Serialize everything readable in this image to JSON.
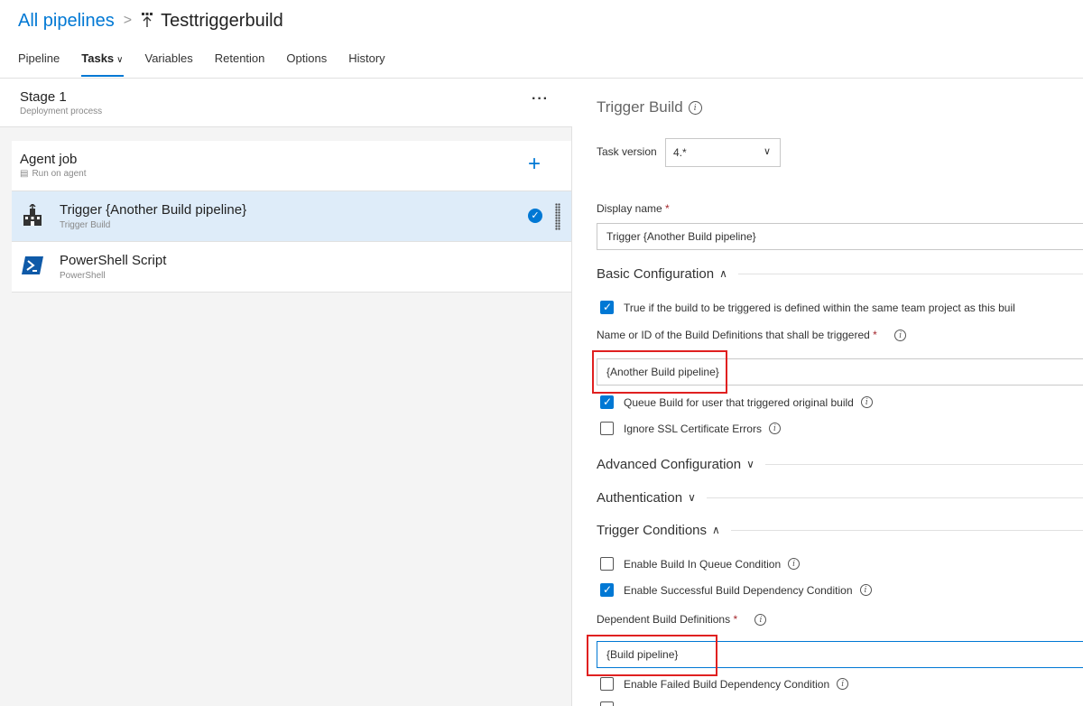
{
  "breadcrumb": {
    "root": "All pipelines",
    "separator": ">",
    "title": "Testtriggerbuild"
  },
  "tabs": [
    {
      "label": "Pipeline"
    },
    {
      "label": "Tasks",
      "active": true
    },
    {
      "label": "Variables"
    },
    {
      "label": "Retention"
    },
    {
      "label": "Options"
    },
    {
      "label": "History"
    }
  ],
  "stage": {
    "title": "Stage 1",
    "subtitle": "Deployment process",
    "more": "···"
  },
  "agent_job": {
    "title": "Agent job",
    "subtitle": "Run on agent",
    "add": "+"
  },
  "tasks": [
    {
      "title": "Trigger {Another Build pipeline}",
      "subtitle": "Trigger Build",
      "selected": true,
      "icon": "factory-icon"
    },
    {
      "title": "PowerShell Script",
      "subtitle": "PowerShell",
      "selected": false,
      "icon": "powershell-icon"
    }
  ],
  "panel": {
    "title": "Trigger Build",
    "task_version_label": "Task version",
    "task_version_value": "4.*",
    "display_name_label": "Display name",
    "required_mark": "*",
    "display_name_value": "Trigger {Another Build pipeline}",
    "basic_config_label": "Basic Configuration",
    "same_project_label": "True if the build to be triggered is defined within the same team project as this buil",
    "build_defs_label": "Name or ID of the Build Definitions that shall be triggered",
    "build_defs_value": "{Another Build pipeline}",
    "queue_user_label": "Queue Build for user that triggered original build",
    "ignore_ssl_label": "Ignore SSL Certificate Errors",
    "advanced_config_label": "Advanced Configuration",
    "authentication_label": "Authentication",
    "trigger_conditions_label": "Trigger Conditions",
    "enable_queue_label": "Enable Build In Queue Condition",
    "enable_success_label": "Enable Successful Build Dependency Condition",
    "dependent_defs_label": "Dependent Build Definitions",
    "dependent_defs_value": "{Build pipeline}",
    "enable_failed_label": "Enable Failed Build Dependency Condition"
  },
  "colors": {
    "accent": "#0078d4",
    "selected_row": "#deecf9",
    "highlight": "#e02020"
  }
}
